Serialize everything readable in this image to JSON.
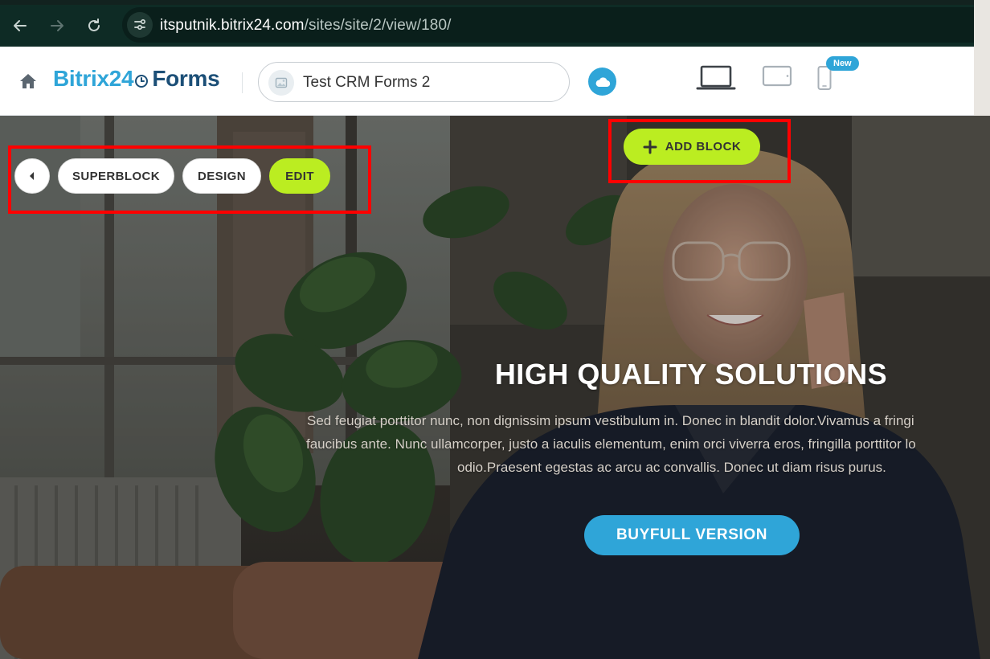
{
  "browser": {
    "url_host": "itsputnik.bitrix24.com",
    "url_path": "/sites/site/2/view/180/"
  },
  "app": {
    "logo_brand": "Bitrix24",
    "logo_product": "Forms",
    "site_name": "Test CRM Forms 2",
    "new_badge": "New"
  },
  "toolbar": {
    "superblock_label": "SUPERBLOCK",
    "design_label": "DESIGN",
    "edit_label": "EDIT",
    "add_block_label": "ADD BLOCK"
  },
  "hero": {
    "title": "HIGH QUALITY SOLUTIONS",
    "text_lines": [
      "Sed feugiat porttitor nunc, non dignissim ipsum vestibulum in. Donec in blandit dolor.Vivamus a fringi",
      "faucibus ante. Nunc ullamcorper, justo a iaculis elementum, enim orci viverra eros, fringilla porttitor lo",
      "odio.Praesent egestas ac arcu ac convallis. Donec ut diam risus purus."
    ],
    "button_label": "BUYFULL VERSION"
  },
  "colors": {
    "accent_green": "#bbed21",
    "accent_blue": "#2fa5d8",
    "logo_dark": "#1c4f77",
    "highlight_red": "#ff0000"
  },
  "icons": [
    "back-arrow-icon",
    "forward-arrow-icon",
    "reload-icon",
    "site-info-icon",
    "home-icon",
    "clock-icon",
    "image-icon",
    "cloud-icon",
    "laptop-icon",
    "tablet-icon",
    "phone-icon",
    "caret-left-icon",
    "plus-icon"
  ]
}
